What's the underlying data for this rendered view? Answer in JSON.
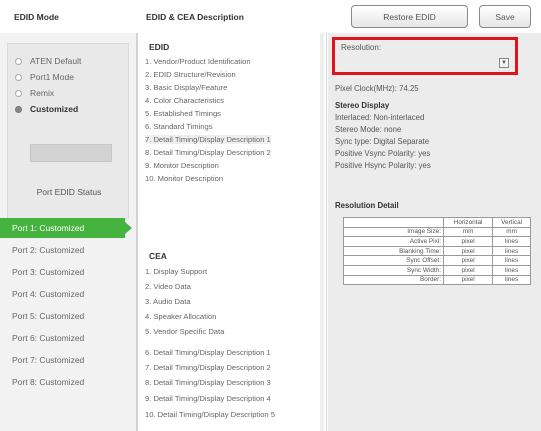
{
  "header": {
    "mode_title": "EDID Mode",
    "desc_title": "EDID & CEA Description",
    "restore_label": "Restore EDID",
    "save_label": "Save"
  },
  "modes": [
    {
      "label": "ATEN Default",
      "selected": false
    },
    {
      "label": "Port1 Mode",
      "selected": false
    },
    {
      "label": "Remix",
      "selected": false
    },
    {
      "label": "Customized",
      "selected": true
    }
  ],
  "port_status_label": "Port EDID Status",
  "ports": [
    {
      "label": "Port 1: Customized",
      "active": true
    },
    {
      "label": "Port 2: Customized",
      "active": false
    },
    {
      "label": "Port 3: Customized",
      "active": false
    },
    {
      "label": "Port 4: Customized",
      "active": false
    },
    {
      "label": "Port 5: Customized",
      "active": false
    },
    {
      "label": "Port 6: Customized",
      "active": false
    },
    {
      "label": "Port 7: Customized",
      "active": false
    },
    {
      "label": "Port 8: Customized",
      "active": false
    }
  ],
  "edid": {
    "heading": "EDID",
    "items": [
      "1.  Vendor/Product Identification",
      "2.  EDID Structure/Revision",
      "3.  Basic Display/Feature",
      "4.  Color Characteristics",
      "5.  Established Timings",
      "6.  Standard Timings",
      "7.  Detail Timing/Display Description 1",
      "8.  Detail Timing/Display Description 2",
      "9.  Monitor Description",
      "10.  Monitor Description"
    ]
  },
  "cea": {
    "heading": "CEA",
    "items": [
      "1.  Display Support",
      "2.  Video Data",
      "3.  Audio Data",
      "4.  Speaker Allocation",
      "5.  Vendor Specific Data",
      "6.  Detail Timing/Display Description 1",
      "7.  Detail Timing/Display Description 2",
      "8.  Detail Timing/Display Description 3",
      "9.  Detail Timing/Display Description 4",
      "10.  Detail Timing/Display Description 5"
    ]
  },
  "detail": {
    "resolution_label": "Resolution:",
    "pixel_clock": "Pixel Clock(MHz): 74.25",
    "stereo_heading": "Stereo Display",
    "lines": [
      "Interlaced: Non-interlaced",
      "Stereo Mode: none",
      "Sync type: Digital Separate",
      "Positive Vsync Polarity: yes",
      "Positive Hsync Polarity: yes"
    ],
    "res_detail_heading": "Resolution Detail",
    "table": {
      "headers": [
        "",
        "Horizontal",
        "Vertical"
      ],
      "rows": [
        [
          "Image Size:",
          "mm",
          "mm"
        ],
        [
          "Active Pixl:",
          "pixel",
          "lines"
        ],
        [
          "Blanking Time:",
          "pixel",
          "lines"
        ],
        [
          "Sync Offset:",
          "pixel",
          "lines"
        ],
        [
          "Sync Width:",
          "pixel",
          "lines"
        ],
        [
          "Border:",
          "pixel",
          "lines"
        ]
      ]
    }
  },
  "colors": {
    "active_port": "#46b23f",
    "highlight_border": "#e0141b"
  }
}
